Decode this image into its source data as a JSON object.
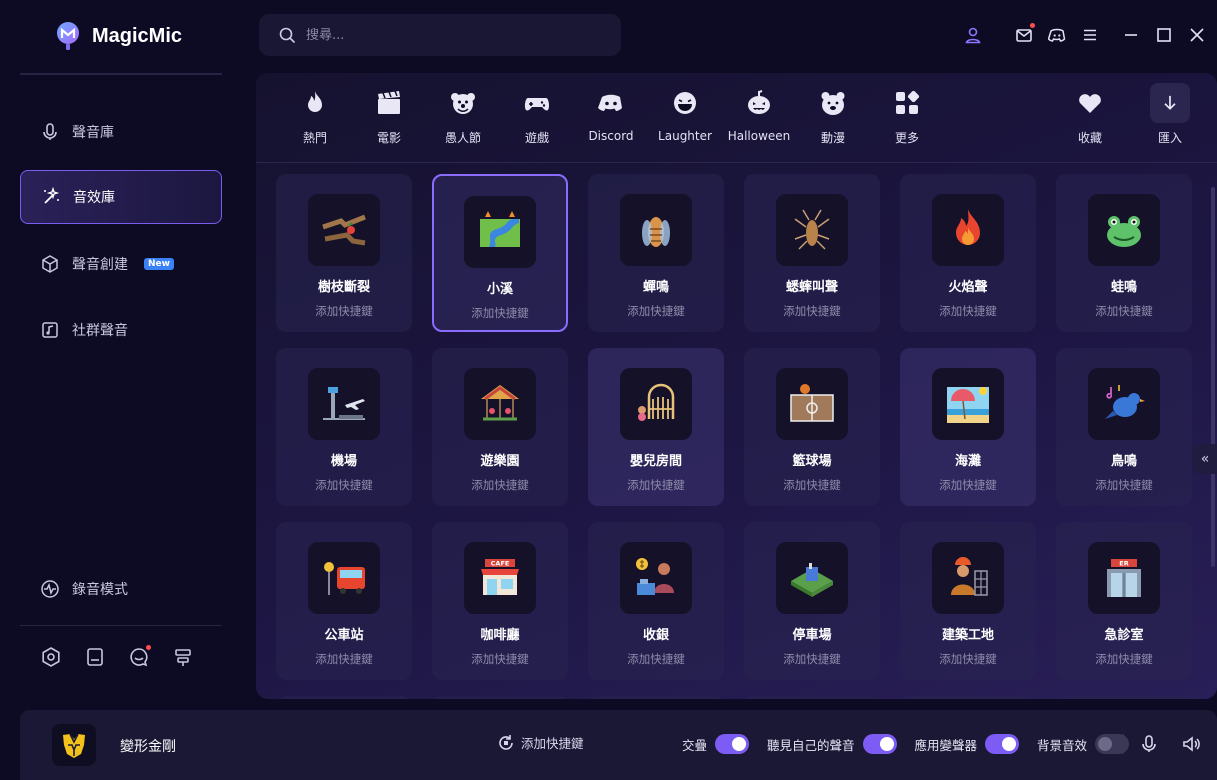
{
  "app": {
    "name": "MagicMic"
  },
  "search": {
    "placeholder": "搜尋..."
  },
  "nav": {
    "items": [
      {
        "label": "聲音庫"
      },
      {
        "label": "音效庫"
      },
      {
        "label": "聲音創建",
        "badge": "New"
      },
      {
        "label": "社群聲音"
      }
    ],
    "record_mode": "錄音模式"
  },
  "categories": [
    {
      "label": "熱門"
    },
    {
      "label": "電影"
    },
    {
      "label": "愚人節"
    },
    {
      "label": "遊戲"
    },
    {
      "label": "Discord"
    },
    {
      "label": "Laughter"
    },
    {
      "label": "Halloween"
    },
    {
      "label": "動漫"
    },
    {
      "label": "更多"
    }
  ],
  "actions": {
    "favorites": "收藏",
    "import": "匯入"
  },
  "sounds": [
    {
      "name": "樹枝斷裂",
      "sub": "添加快捷鍵"
    },
    {
      "name": "小溪",
      "sub": "添加快捷鍵"
    },
    {
      "name": "蟬鳴",
      "sub": "添加快捷鍵"
    },
    {
      "name": "蟋蟀叫聲",
      "sub": "添加快捷鍵"
    },
    {
      "name": "火焰聲",
      "sub": "添加快捷鍵"
    },
    {
      "name": "蛙鳴",
      "sub": "添加快捷鍵"
    },
    {
      "name": "機場",
      "sub": "添加快捷鍵"
    },
    {
      "name": "遊樂園",
      "sub": "添加快捷鍵"
    },
    {
      "name": "嬰兒房間",
      "sub": "添加快捷鍵"
    },
    {
      "name": "籃球場",
      "sub": "添加快捷鍵"
    },
    {
      "name": "海灘",
      "sub": "添加快捷鍵"
    },
    {
      "name": "鳥鳴",
      "sub": "添加快捷鍵"
    },
    {
      "name": "公車站",
      "sub": "添加快捷鍵"
    },
    {
      "name": "咖啡廳",
      "sub": "添加快捷鍵"
    },
    {
      "name": "收銀",
      "sub": "添加快捷鍵"
    },
    {
      "name": "停車場",
      "sub": "添加快捷鍵"
    },
    {
      "name": "建築工地",
      "sub": "添加快捷鍵"
    },
    {
      "name": "急診室",
      "sub": "添加快捷鍵"
    }
  ],
  "thumb_text": {
    "cafe": "CAFE",
    "er": "ER"
  },
  "bottom": {
    "voice_name": "變形金剛",
    "add_shortcut": "添加快捷鍵",
    "toggles": [
      {
        "label": "交疊",
        "on": true
      },
      {
        "label": "聽見自己的聲音",
        "on": true
      },
      {
        "label": "應用變聲器",
        "on": true
      },
      {
        "label": "背景音效",
        "on": false
      }
    ]
  },
  "colors": {
    "accent": "#7c5cf5",
    "bg": "#0d0b24",
    "panel": "#1d1643"
  }
}
